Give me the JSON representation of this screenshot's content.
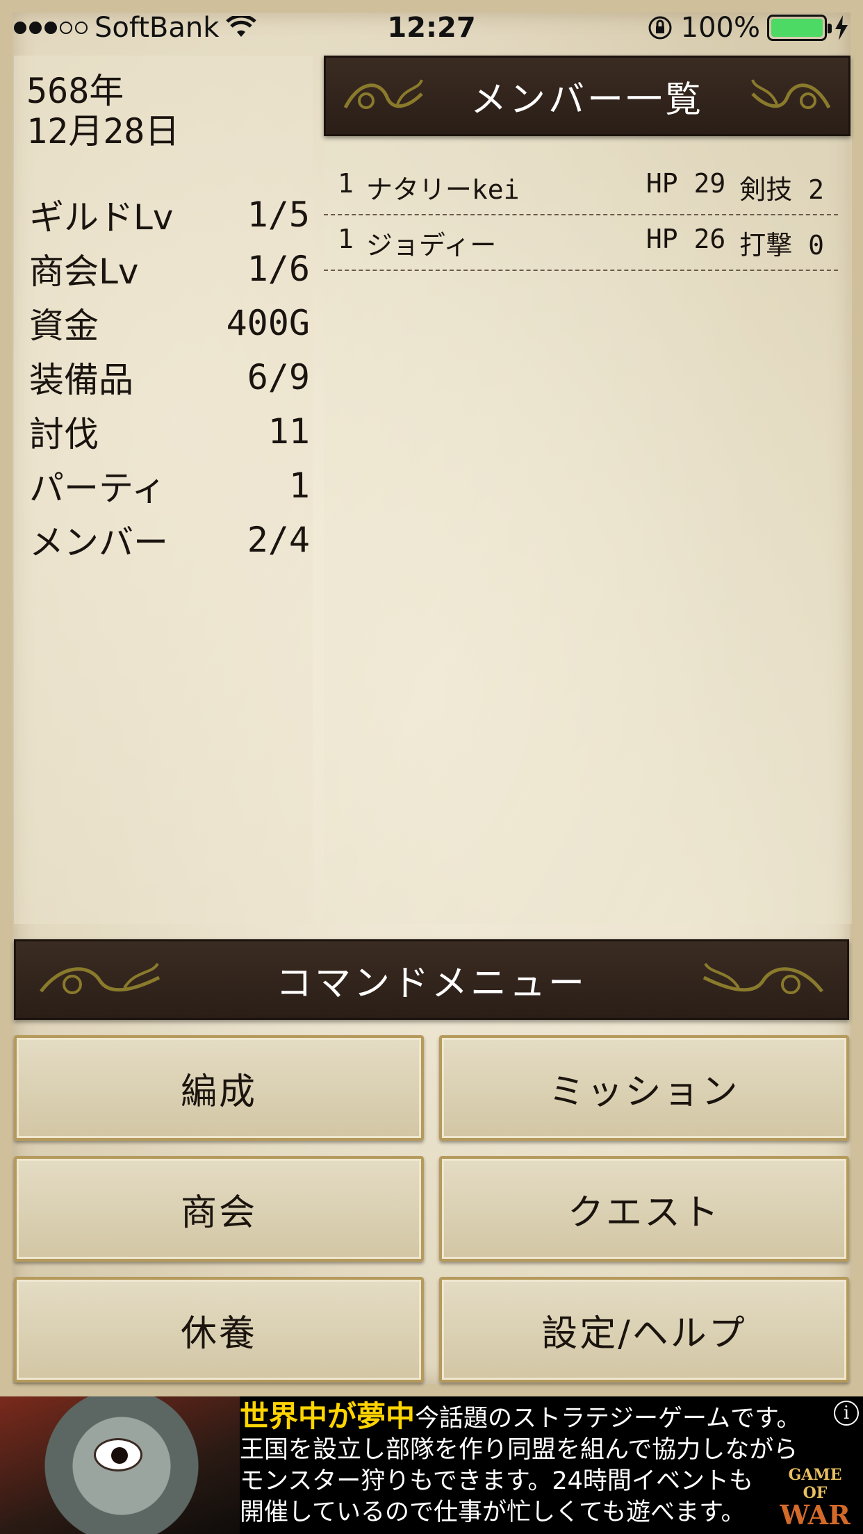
{
  "status_bar": {
    "carrier": "SoftBank",
    "time": "12:27",
    "battery_percent": "100%",
    "signal_bars_filled": 3,
    "signal_bars_total": 5,
    "battery_color": "#4cd964"
  },
  "info": {
    "year": "568年",
    "date": "12月28日",
    "stats": [
      {
        "label": "ギルドLv",
        "value": "1/5"
      },
      {
        "label": "商会Lv",
        "value": "1/6"
      },
      {
        "label": "資金",
        "value": "400G"
      },
      {
        "label": "装備品",
        "value": "6/9"
      },
      {
        "label": "討伐",
        "value": "11"
      },
      {
        "label": "パーティ",
        "value": "1"
      },
      {
        "label": "メンバー",
        "value": "2/4"
      }
    ]
  },
  "members": {
    "title": "メンバー一覧",
    "rows": [
      {
        "party": "1",
        "name": "ナタリーkei",
        "hp": "HP 29",
        "skill": "剣技 2"
      },
      {
        "party": "1",
        "name": "ジョディー",
        "hp": "HP 26",
        "skill": "打撃 0"
      }
    ]
  },
  "command_menu": {
    "title": "コマンドメニュー",
    "buttons": [
      {
        "label": "編成"
      },
      {
        "label": "ミッション"
      },
      {
        "label": "商会"
      },
      {
        "label": "クエスト"
      },
      {
        "label": "休養"
      },
      {
        "label": "設定/ヘルプ"
      }
    ]
  },
  "ad": {
    "headline": "世界中が夢中",
    "line1": "今話題のストラテジーゲームです。",
    "line2": "王国を設立し部隊を作り同盟を組んで協力しながら",
    "line3": "モンスター狩りもできます。24時間イベントも",
    "line4": "開催しているので仕事が忙しくても遊べます。",
    "info_label": "i",
    "logo_top": "GAME OF",
    "logo_bottom": "WAR"
  },
  "colors": {
    "header_bg": "#2f2219",
    "parchment": "#e6dcc3",
    "button_border": "#b59a5c",
    "ad_headline": "#ffd400"
  }
}
